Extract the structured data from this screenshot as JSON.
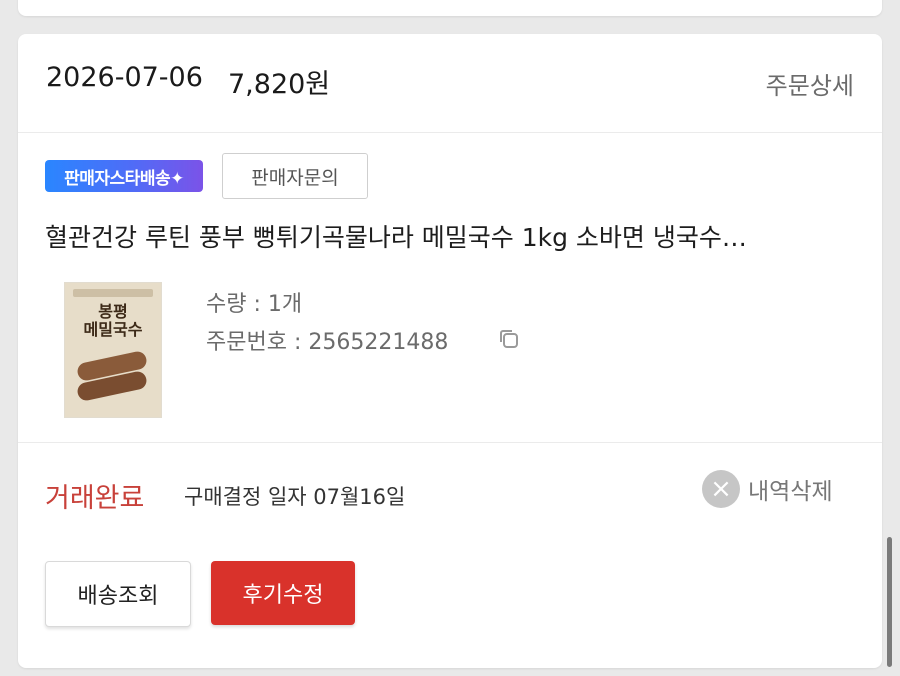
{
  "order": {
    "date": "2026-07-06",
    "price": "7,820원",
    "detail_label": "주문상세",
    "badge_star_delivery": "판매자스타배송✦",
    "seller_inquiry_label": "판매자문의",
    "product_title": "혈관건강 루틴 풍부 뻥튀기곡물나라 메밀국수 1kg 소바면 냉국수…",
    "thumbnail_title": "봉평\n메밀국수",
    "quantity": "수량 : 1개",
    "order_number": "주문번호 : 2565221488",
    "status": "거래완료",
    "purchase_confirm": "구매결정 일자 07월16일",
    "delete_label": "내역삭제",
    "tracking_label": "배송조회",
    "review_label": "후기수정"
  },
  "icons": {
    "copy": "copy-icon",
    "delete": "close-circle-icon"
  },
  "colors": {
    "status_red": "#c8413a",
    "review_button": "#d9322b",
    "badge_gradient_start": "#2a86ff",
    "badge_gradient_end": "#7b53e8"
  }
}
